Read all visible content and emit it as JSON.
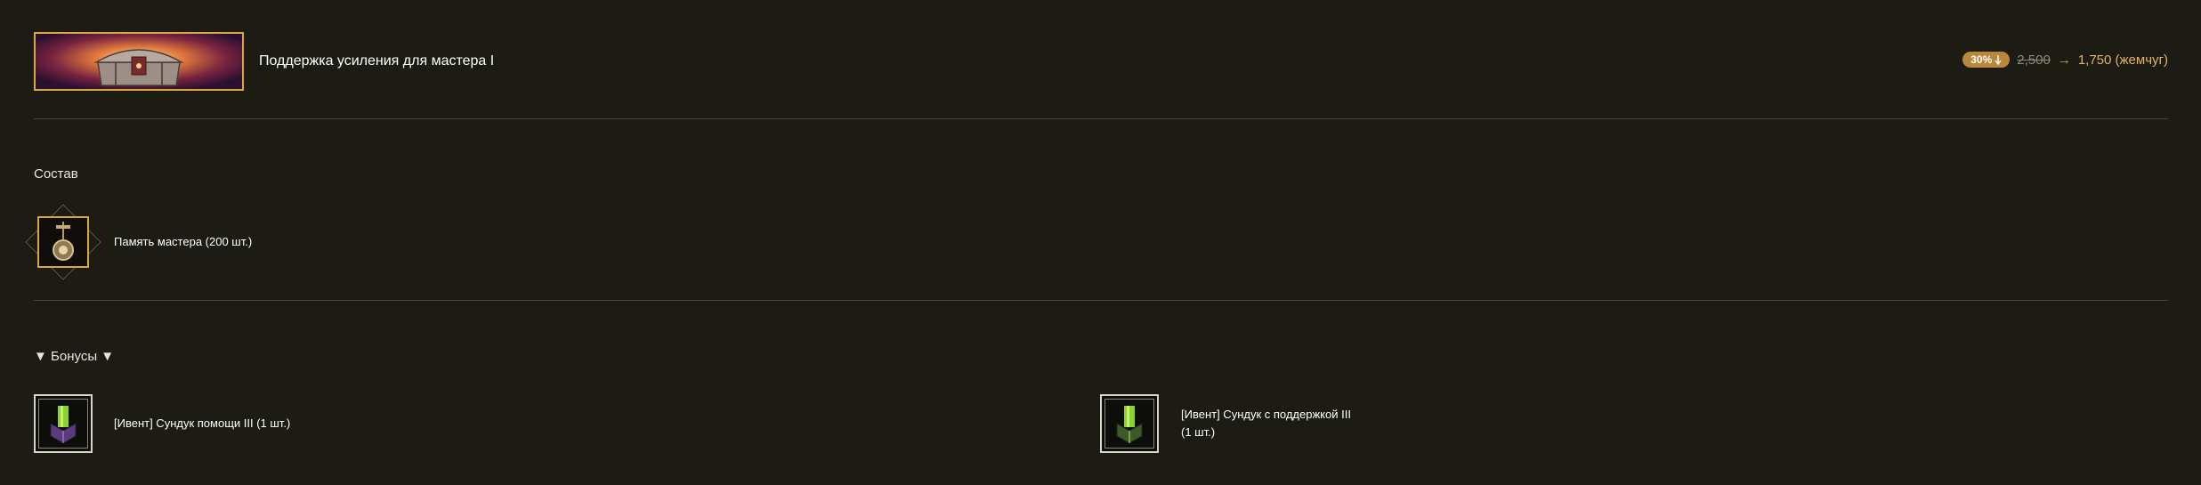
{
  "product": {
    "title": "Поддержка усиления для мастера I",
    "thumbnail_icon": "treasure-chest-icon"
  },
  "price": {
    "discount": "30%",
    "discount_icon": "down-arrow-icon",
    "old_price": "2,500",
    "arrow": "→",
    "new_price": "1,750 (жемчуг)"
  },
  "composition": {
    "title": "Состав",
    "items": [
      {
        "label": "Память мастера (200 шт.)",
        "icon": "amulet-icon"
      }
    ]
  },
  "bonuses": {
    "title": "▼ Бонусы ▼",
    "items": [
      {
        "label": "[Ивент] Сундук помощи III (1 шт.)",
        "icon": "green-crystal-box-icon"
      },
      {
        "label_line1": "[Ивент] Сундук с поддержкой III",
        "label_line2": "(1 шт.)",
        "icon": "green-crystal-box-icon"
      }
    ]
  },
  "colors": {
    "background": "#1c1b14",
    "accent_gold": "#d9a640",
    "price_gold": "#e3b463",
    "divider": "#4a4733"
  }
}
